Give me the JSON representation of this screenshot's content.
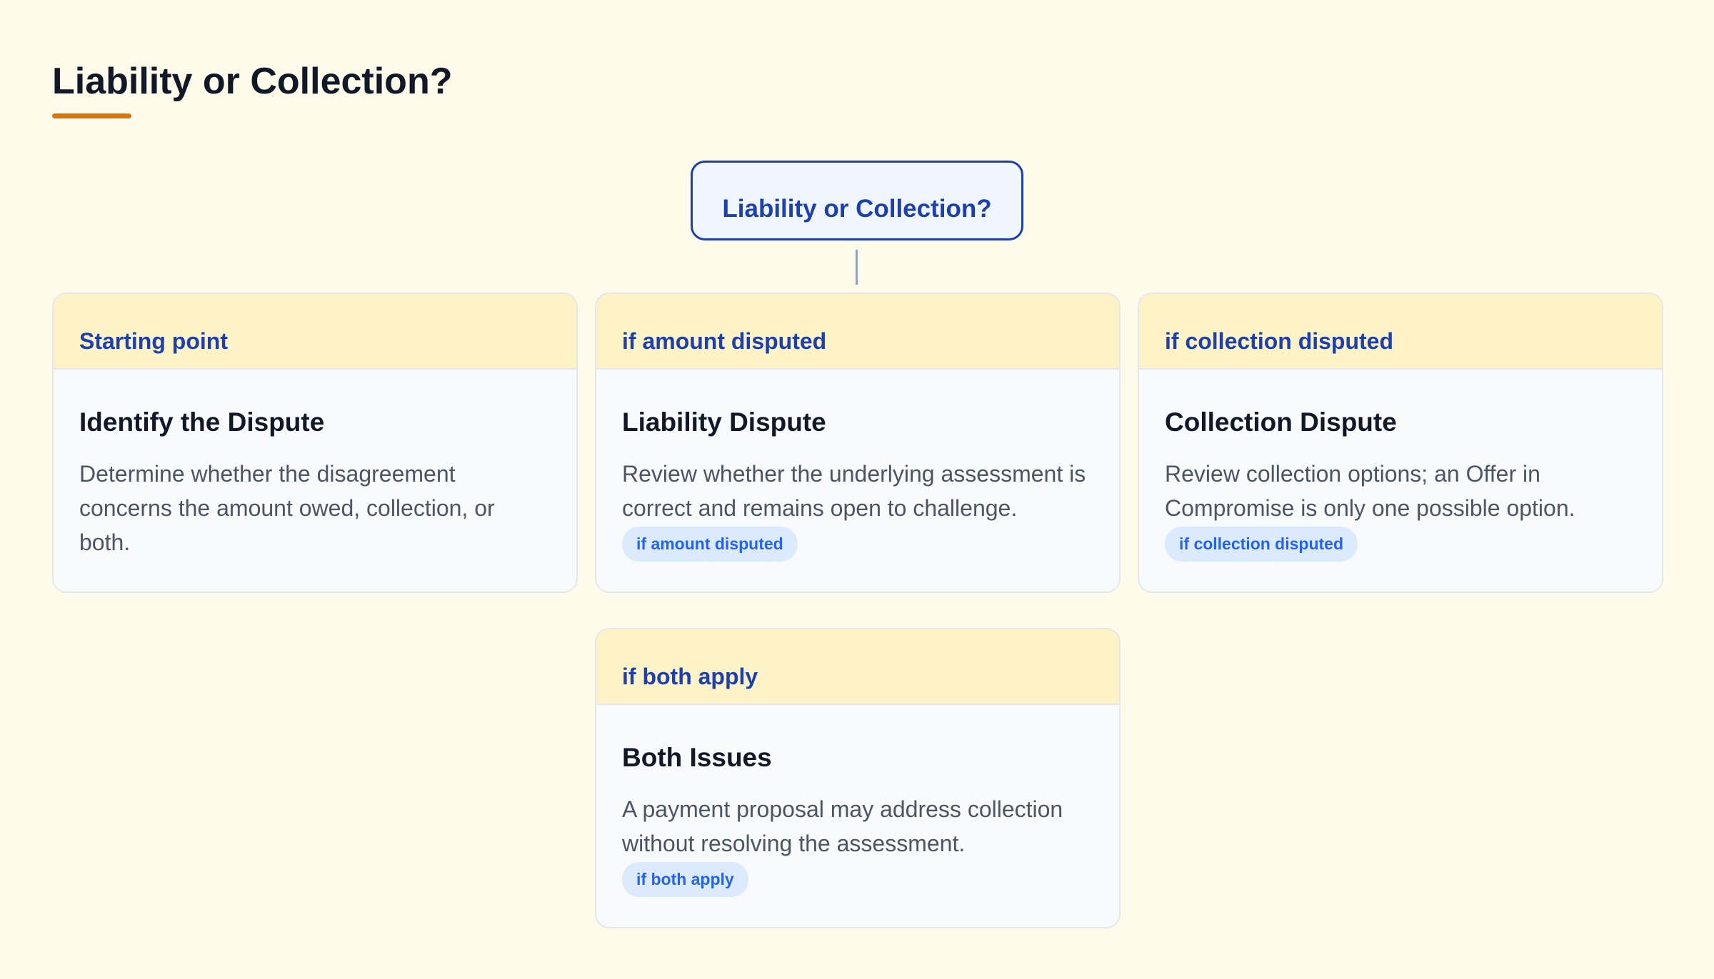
{
  "title": "Liability or Collection?",
  "colors": {
    "background": "#fefbea",
    "accent": "#d97706",
    "node_border": "#1e40af",
    "card_header": "#fef3c7",
    "badge_bg": "#dbeafe",
    "badge_text": "#2563eb"
  },
  "root": {
    "label": "Liability or Collection?"
  },
  "cards": [
    {
      "header": "Starting point",
      "title": "Identify the Dispute",
      "description": "Determine whether the disagreement concerns the amount owed, collection, or both.",
      "badge": ""
    },
    {
      "header": "if amount disputed",
      "title": "Liability Dispute",
      "description": "Review whether the underlying assessment is correct and remains open to challenge.",
      "badge": "if amount disputed"
    },
    {
      "header": "if collection disputed",
      "title": "Collection Dispute",
      "description": "Review collection options; an Offer in Compromise is only one possible option.",
      "badge": "if collection disputed"
    },
    {
      "header": "if both apply",
      "title": "Both Issues",
      "description": "A payment proposal may address collection without resolving the assessment.",
      "badge": "if both apply"
    }
  ]
}
